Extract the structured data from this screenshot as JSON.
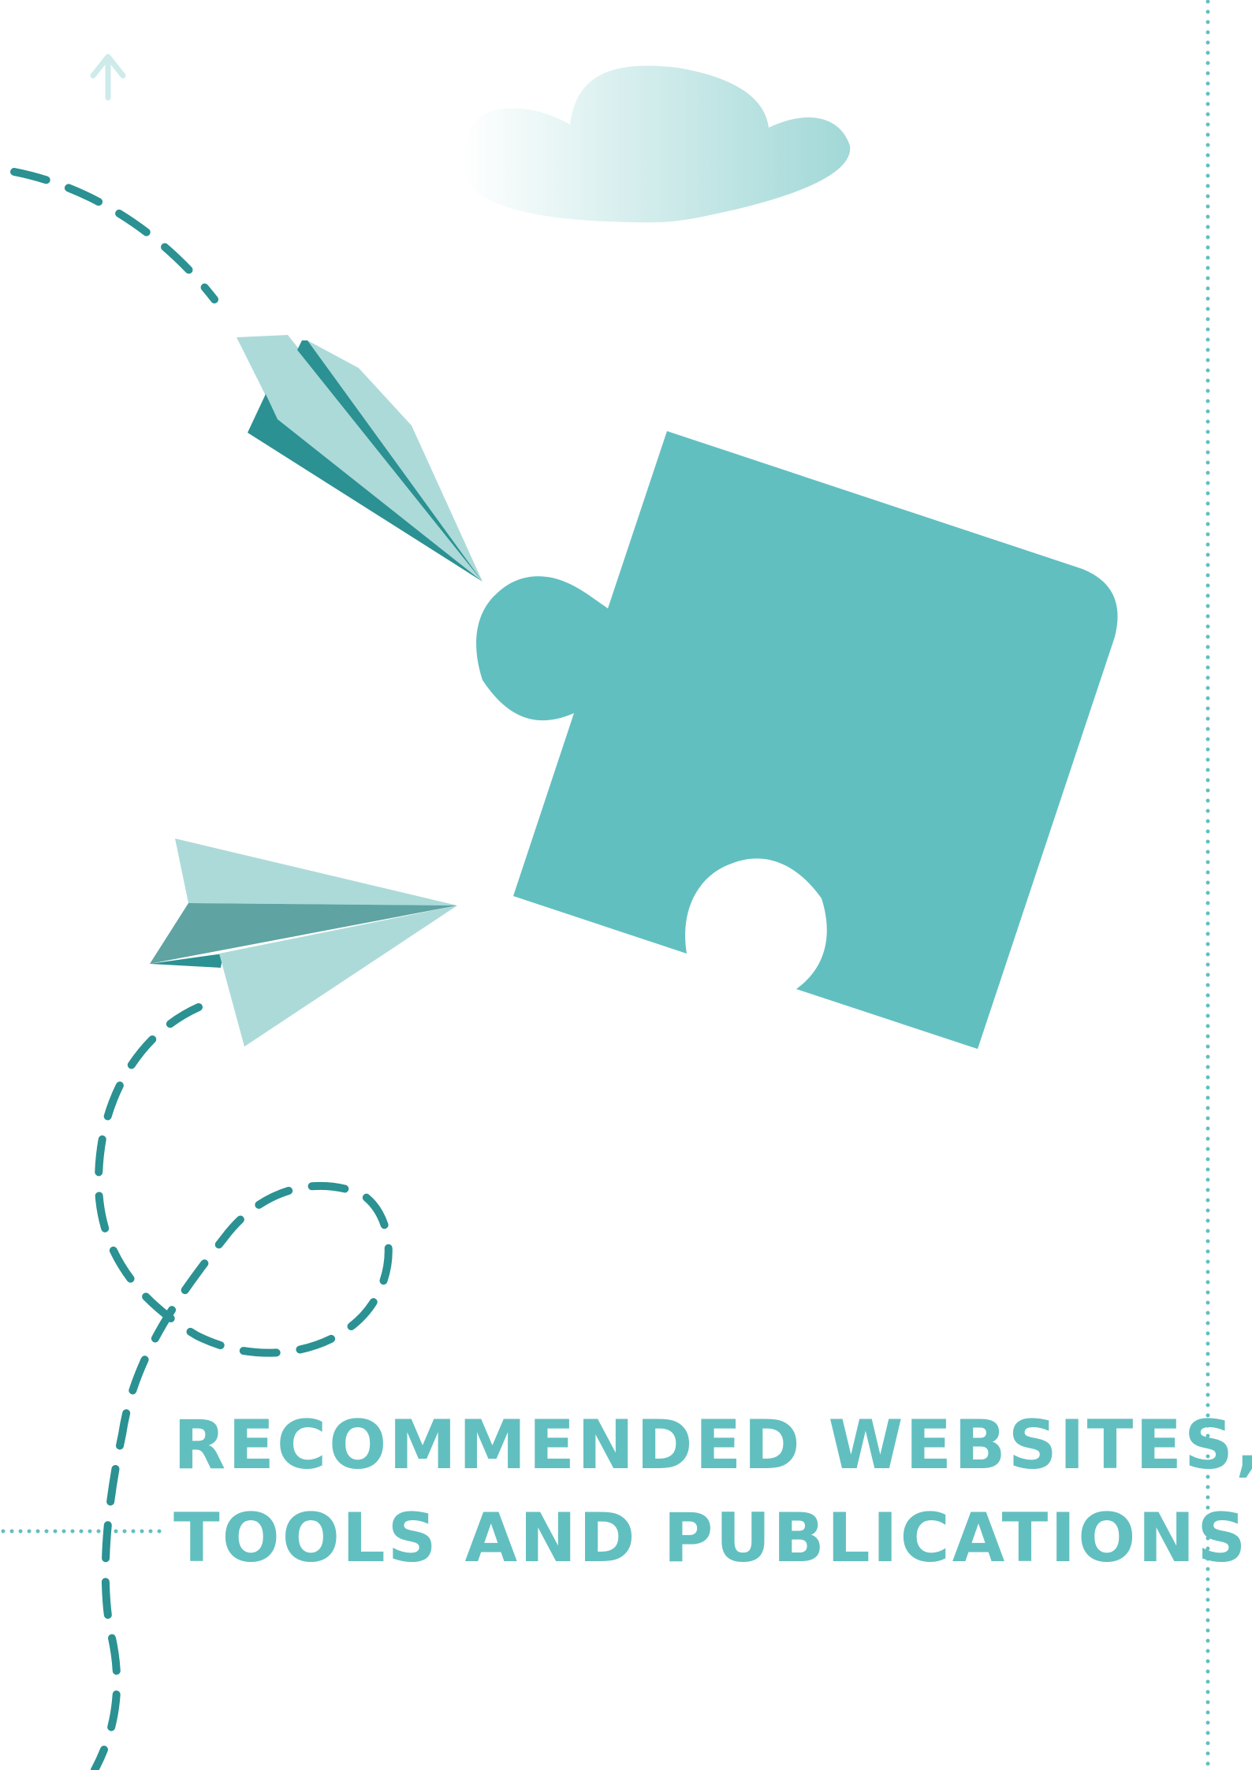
{
  "page": {
    "title_line_1": "RECOMMENDED WEBSITES,",
    "title_line_2": "TOOLS AND PUBLICATIONS"
  },
  "colors": {
    "background": "#ffffff",
    "accent_teal": "#62bfc0",
    "dark_teal": "#2b9192",
    "light_teal": "#acdad9",
    "muted_teal": "#5fa3a3",
    "dotted_line": "#62bfc0"
  },
  "icons": [
    "up-arrow-icon",
    "cloud-icon",
    "paper-plane-icon",
    "puzzle-piece-icon"
  ]
}
